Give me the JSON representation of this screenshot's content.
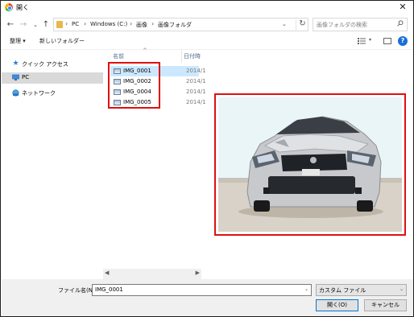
{
  "window": {
    "title": "開く"
  },
  "address": {
    "crumbs": [
      "PC",
      "Windows (C:)",
      "画像",
      "画像フォルダ"
    ]
  },
  "search": {
    "placeholder": "画像フォルダの検索"
  },
  "toolbar": {
    "organize": "整理 ▾",
    "new_folder": "新しいフォルダー"
  },
  "sidebar": {
    "items": [
      {
        "label": "クイック アクセス",
        "icon": "star-icon"
      },
      {
        "label": "PC",
        "icon": "computer-icon",
        "selected": true
      },
      {
        "label": "ネットワーク",
        "icon": "network-icon"
      }
    ]
  },
  "files": {
    "columns": {
      "name": "名前",
      "date": "日付時"
    },
    "rows": [
      {
        "name": "IMG_0001",
        "date": "2014/1",
        "selected": true
      },
      {
        "name": "IMG_0002",
        "date": "2014/1"
      },
      {
        "name": "IMG_0004",
        "date": "2014/1"
      },
      {
        "name": "IMG_0005",
        "date": "2014/1"
      }
    ]
  },
  "filename": {
    "label": "ファイル名(N):",
    "value": "IMG_0001"
  },
  "filter": {
    "value": "カスタム ファイル"
  },
  "buttons": {
    "open": "開く(O)",
    "cancel": "キャンセル"
  },
  "colors": {
    "highlight": "#e01010",
    "selection": "#cce8ff",
    "accent": "#0078d7"
  }
}
